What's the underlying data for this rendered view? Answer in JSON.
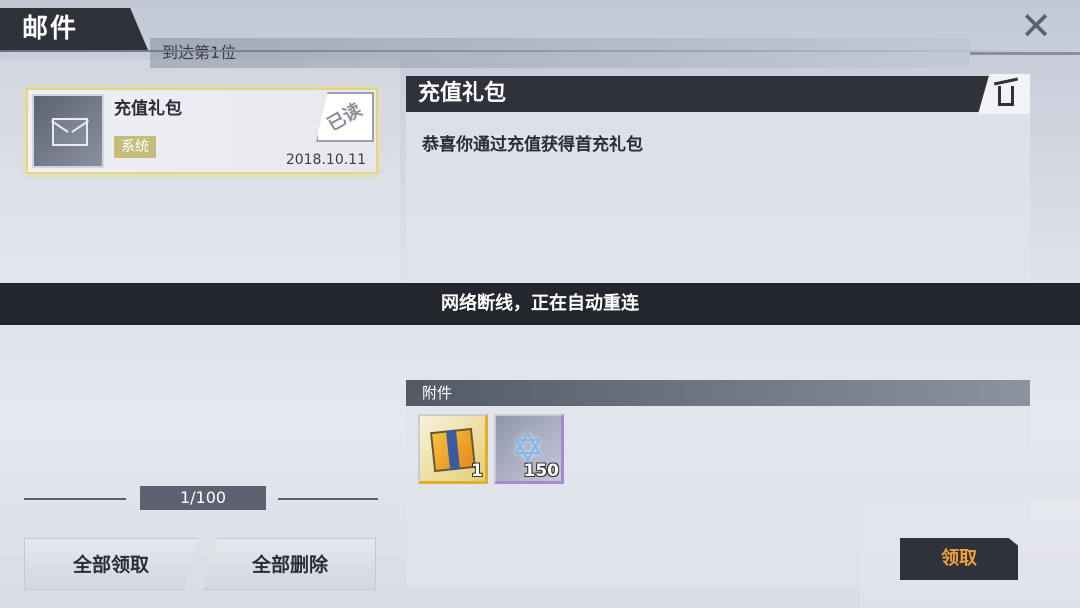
{
  "header": {
    "title": "邮件",
    "ticker_text": "到达第1位"
  },
  "mail_list": {
    "items": [
      {
        "title": "充值礼包",
        "tag": "系统",
        "date": "2018.10.11",
        "status": "已读"
      }
    ]
  },
  "pagination": {
    "label": "1/100"
  },
  "actions": {
    "claim_all_label": "全部领取",
    "delete_all_label": "全部删除"
  },
  "detail": {
    "title": "充值礼包",
    "body": "恭喜你通过充值获得首充礼包"
  },
  "notice": {
    "text": "网络断线，正在自动重连"
  },
  "attachments": {
    "header": "附件",
    "items": [
      {
        "icon": "gift-box-icon",
        "count": "1",
        "rarity_color": "#e3ad2c"
      },
      {
        "icon": "crystal-star-icon",
        "count": "150",
        "rarity_color": "#a48ad0"
      }
    ]
  },
  "claim_button": {
    "label": "领取",
    "color": "#f0a03c"
  }
}
